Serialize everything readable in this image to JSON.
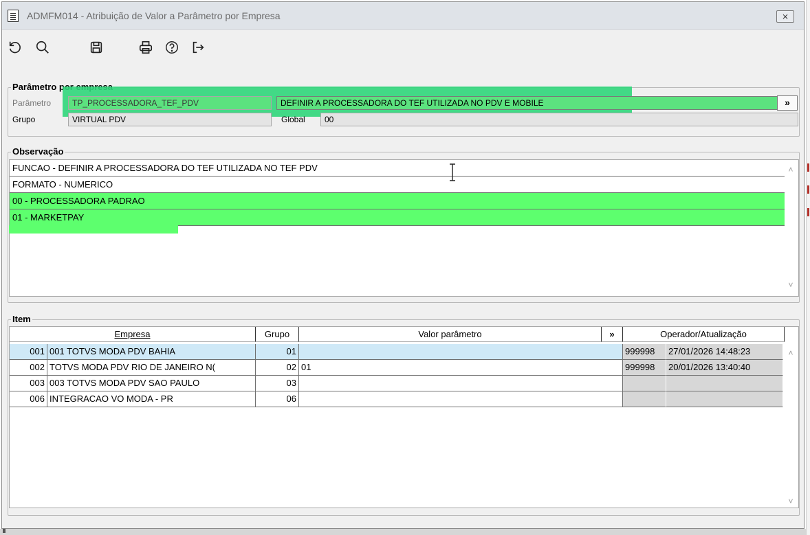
{
  "window": {
    "title": "ADMFM014 - Atribuição de Valor a Parâmetro por Empresa",
    "close_label": "⨯"
  },
  "toolbar": {
    "buttons": [
      {
        "name": "undo-icon"
      },
      {
        "name": "search-icon"
      },
      {
        "name": "save-icon"
      },
      {
        "name": "print-icon"
      },
      {
        "name": "help-icon"
      },
      {
        "name": "exit-icon"
      }
    ]
  },
  "parametro_empresa": {
    "title": "Parâmetro por empresa",
    "parametro_label": "Parâmetro",
    "parametro_code": "TP_PROCESSADORA_TEF_PDV",
    "parametro_desc": "DEFINIR A PROCESSADORA DO TEF UTILIZADA NO PDV E MOBILE",
    "more_label": "»",
    "grupo_label": "Grupo",
    "grupo_value": "VIRTUAL PDV",
    "global_label": "Global",
    "global_value": "00"
  },
  "observacao": {
    "title": "Observação",
    "lines": [
      "FUNCAO - DEFINIR A PROCESSADORA DO TEF UTILIZADA NO TEF PDV",
      "FORMATO - NUMERICO",
      "00 - PROCESSADORA PADRAO",
      "01 - MARKETPAY"
    ]
  },
  "item": {
    "title": "Item",
    "columns": {
      "empresa": "Empresa",
      "grupo": "Grupo",
      "valor": "Valor parâmetro",
      "more": "»",
      "operador": "Operador/Atualização"
    },
    "rows": [
      {
        "code": "001",
        "empresa": "001  TOTVS MODA PDV  BAHIA",
        "grupo": "01",
        "valor": "",
        "operador": "999998",
        "data": "27/01/2026 14:48:23",
        "selected": true
      },
      {
        "code": "002",
        "empresa": "TOTVS MODA PDV  RIO DE JANEIRO  N(",
        "grupo": "02",
        "valor": "01",
        "operador": "999998",
        "data": "20/01/2026 13:40:40",
        "selected": false
      },
      {
        "code": "003",
        "empresa": "003  TOTVS MODA PDV  SAO PAULO",
        "grupo": "03",
        "valor": "",
        "operador": "",
        "data": "",
        "selected": false
      },
      {
        "code": "006",
        "empresa": "INTEGRACAO VO MODA - PR",
        "grupo": "06",
        "valor": "",
        "operador": "",
        "data": "",
        "selected": false
      }
    ]
  },
  "colors": {
    "highlight_green": "#5dff6e",
    "selection_blue": "#cfe9f7"
  }
}
